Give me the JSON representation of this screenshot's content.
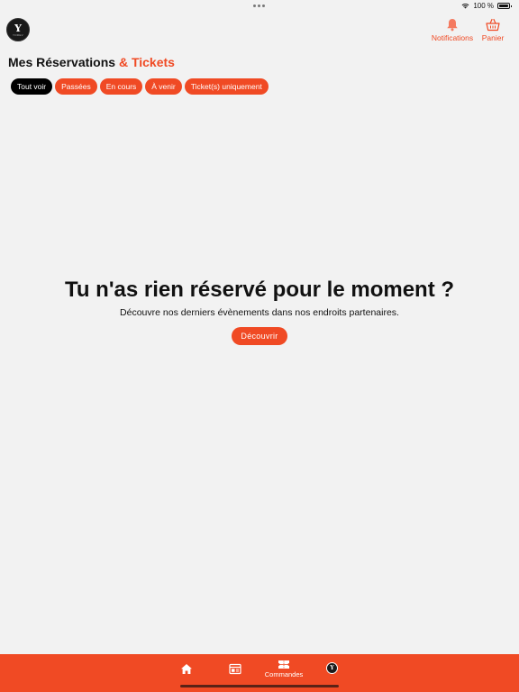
{
  "status": {
    "battery_text": "100 %",
    "battery_level": 1.0
  },
  "brand": {
    "logo_letter": "Y",
    "logo_text": "YOREV"
  },
  "header": {
    "notifications_label": "Notifications",
    "cart_label": "Panier"
  },
  "page": {
    "title_main": "Mes Réservations",
    "title_accent": "& Tickets"
  },
  "filters": [
    {
      "label": "Tout voir",
      "active": true
    },
    {
      "label": "Passées",
      "active": false
    },
    {
      "label": "En cours",
      "active": false
    },
    {
      "label": "À venir",
      "active": false
    },
    {
      "label": "Ticket(s) uniquement",
      "active": false
    }
  ],
  "empty_state": {
    "title": "Tu n'as rien réservé pour le moment ?",
    "subtitle": "Découvre nos derniers évènements dans nos endroits partenaires.",
    "cta_label": "Découvrir"
  },
  "tabbar": {
    "items": [
      {
        "icon": "home-icon",
        "label": ""
      },
      {
        "icon": "events-icon",
        "label": ""
      },
      {
        "icon": "ticket-icon",
        "label": "Commandes"
      },
      {
        "icon": "profile-avatar-icon",
        "label": ""
      }
    ]
  },
  "colors": {
    "accent": "#f04a24",
    "background": "#f2f2f2",
    "active_chip": "#000000"
  }
}
